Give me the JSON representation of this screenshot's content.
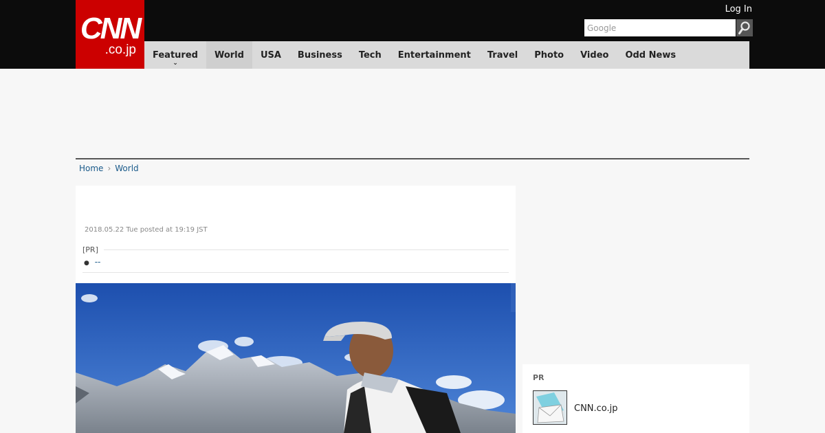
{
  "header": {
    "logo_main": "CNN",
    "logo_sub": ".co.jp",
    "login_label": "Log In",
    "search_placeholder": "Google",
    "brand_color": "#cc0000"
  },
  "nav": {
    "items": [
      {
        "label": "Featured"
      },
      {
        "label": "World"
      },
      {
        "label": "USA"
      },
      {
        "label": "Business"
      },
      {
        "label": "Tech"
      },
      {
        "label": "Entertainment"
      },
      {
        "label": "Travel"
      },
      {
        "label": "Photo"
      },
      {
        "label": "Video"
      },
      {
        "label": "Odd News"
      }
    ],
    "active": "World"
  },
  "breadcrumb": {
    "home": "Home",
    "current": "World"
  },
  "article": {
    "timestamp": "2018.05.22 Tue posted at 19:19 JST",
    "pr_label": "[PR]",
    "pr_item_text": "--"
  },
  "sidebar": {
    "pr_label": "PR",
    "pr_item_text": "CNN.co.jp"
  }
}
